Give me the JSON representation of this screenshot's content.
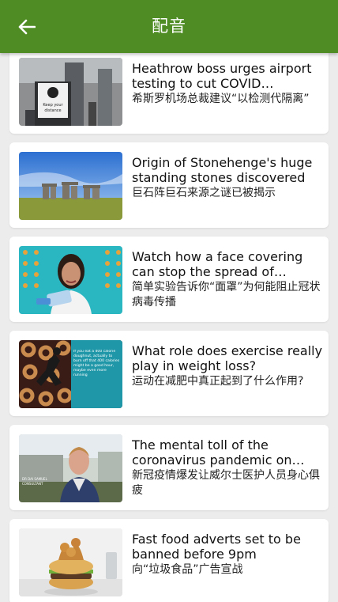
{
  "app": {
    "title": "配音",
    "accent": "#4f8c24"
  },
  "articles": [
    {
      "title_en": "Heathrow boss urges airport testing to cut COVID quarantine time",
      "title_zh": "希斯罗机场总裁建议“以检测代隔离”"
    },
    {
      "title_en": "Origin of Stonehenge's huge standing stones discovered",
      "title_zh": "巨石阵巨石来源之谜已被揭示"
    },
    {
      "title_en": "Watch how a face covering can stop the spread of coronavirus",
      "title_zh": "简单实验告诉你“面罩”为何能阻止冠状病毒传播"
    },
    {
      "title_en": "What role does exercise really play in weight loss?",
      "title_zh": "运动在减肥中真正起到了什么作用?"
    },
    {
      "title_en": "The mental toll of the coronavirus pandemic on healthcare workers in Wales",
      "title_zh": "新冠疫情爆发让威尔士医护人员身心俱疲"
    },
    {
      "title_en": "Fast food adverts set to be banned before 9pm",
      "title_zh": "向“垃圾食品”广告宣战"
    }
  ],
  "thumb_text": {
    "sign_line1": "Keep your",
    "sign_line2": "distance",
    "doughnut_caption": "If you eat a 400 calorie doughnut, actually to burn off that 400 calories might be a good hour, maybe even more running",
    "doctor_caption1": "DR DAI SAMUEL",
    "doctor_caption2": "CONSULTANT"
  }
}
